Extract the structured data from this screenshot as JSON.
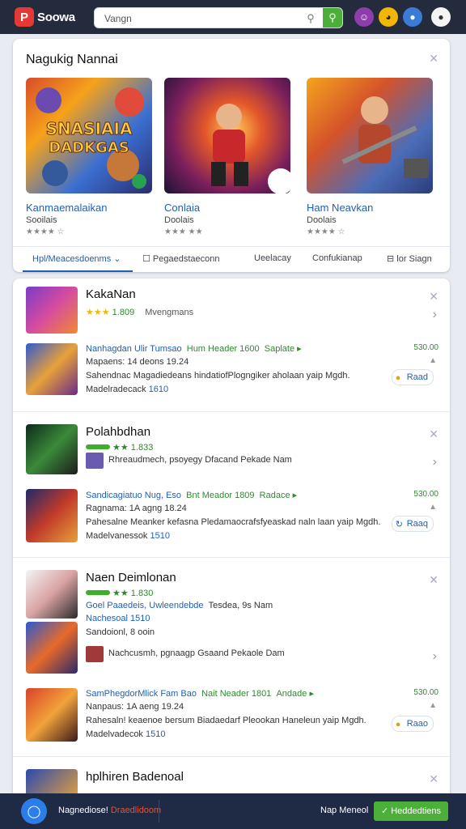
{
  "header": {
    "logo_mark": "P",
    "logo_text": "Soowa",
    "search_value": "Vangn",
    "search_icon": "search-icon",
    "go_icon": "go-icon",
    "icons": [
      "smiley-icon",
      "cat-icon",
      "avatar",
      "avatar"
    ]
  },
  "featured": {
    "title": "Nagukig Nannai",
    "items": [
      {
        "art_text_1": "SNASIAIA",
        "art_text_2": "DADKGAS",
        "title": "Kanmaemalaikan",
        "subtitle": "Sooilais",
        "stars": "★★★★ ☆"
      },
      {
        "title": "Conlaia",
        "subtitle": "Doolais",
        "stars": "★★★ ★★"
      },
      {
        "title": "Ham Neavkan",
        "subtitle": "Doolais",
        "stars": "★★★★ ☆"
      }
    ],
    "tabs": [
      {
        "label": "Hpl/Meacesdoenms ⌄"
      },
      {
        "label": "☐ Pegaedstaeconn"
      },
      {
        "label": "Ueelacay"
      },
      {
        "label": "Confukianap"
      },
      {
        "label": "⊟ lor Siagn"
      }
    ]
  },
  "list": [
    {
      "title": "KakaNan",
      "rating_stars": "★★★",
      "rating_count": "1.809",
      "meta": "Mvengmans",
      "entry_title": "Nanhagdan Ulir Tumsao",
      "entry_header": "Hum Header 1600",
      "entry_extra": "Saplate",
      "entry_right": "530.00",
      "entry_line2": "Mapaens: 14 deons 19.24",
      "entry_line3": "Sahendnac Magadiedeans hindatiofPlogngiker aholaan yaip Mgdh.",
      "entry_line4": "Madelradecack",
      "entry_link": "1610",
      "pill": "Raad"
    },
    {
      "title": "Polahbdhan",
      "rating_stars": "★★",
      "rating_count": "1.833",
      "sub": "Rhreaudmech, psoyegy Dfacand Pekade Nam",
      "entry_title": "Sandicagiatuo Nug, Eso",
      "entry_header": "Bnt Meador 1809",
      "entry_extra": "Radace",
      "entry_right": "530.00",
      "entry_line2": "Ragnama: 1A agng 18.24",
      "entry_line3": "Pahesalne Meanker kefasna Pledamaocrafsfyeaskad naln laan yaip Mgdh.",
      "entry_line4": "Madelvanessok",
      "entry_link": "1510",
      "pill": "Raaq"
    },
    {
      "title": "Naen Deimlonan",
      "rating_stars": "★★",
      "rating_count": "1.830",
      "link_a": "Goel Paaedeis, Uwleendebde",
      "tail_a": "Tesdea, 9s Nam",
      "link_b": "Nachesoal",
      "link_b_num": "1510",
      "sub_b": "Sandoionl, 8 ooin",
      "sub": "Nachcusmh, pgnaagp Gsaand Pekaole Dam",
      "entry_title": "SamPhegdorMlick Fam Bao",
      "entry_header": "Nait Neader 1801",
      "entry_extra": "Andade",
      "entry_right": "530.00",
      "entry_line2": "Nanpaus: 1A aeng 19.24",
      "entry_line3": "Rahesaln! keaenoe bersum Biadaedarf Pleookan Haneleun yaip Mgdh.",
      "entry_line4": "Madelvadecok",
      "entry_link": "1510",
      "pill": "Raao"
    },
    {
      "title": "hplhiren Badenoal"
    }
  ],
  "bottom": {
    "status_label": "Nagnediose!",
    "status_value": "Draedlidoom",
    "right_label": "Nap Meneol",
    "button_label": "✓ Heddedtiens"
  }
}
